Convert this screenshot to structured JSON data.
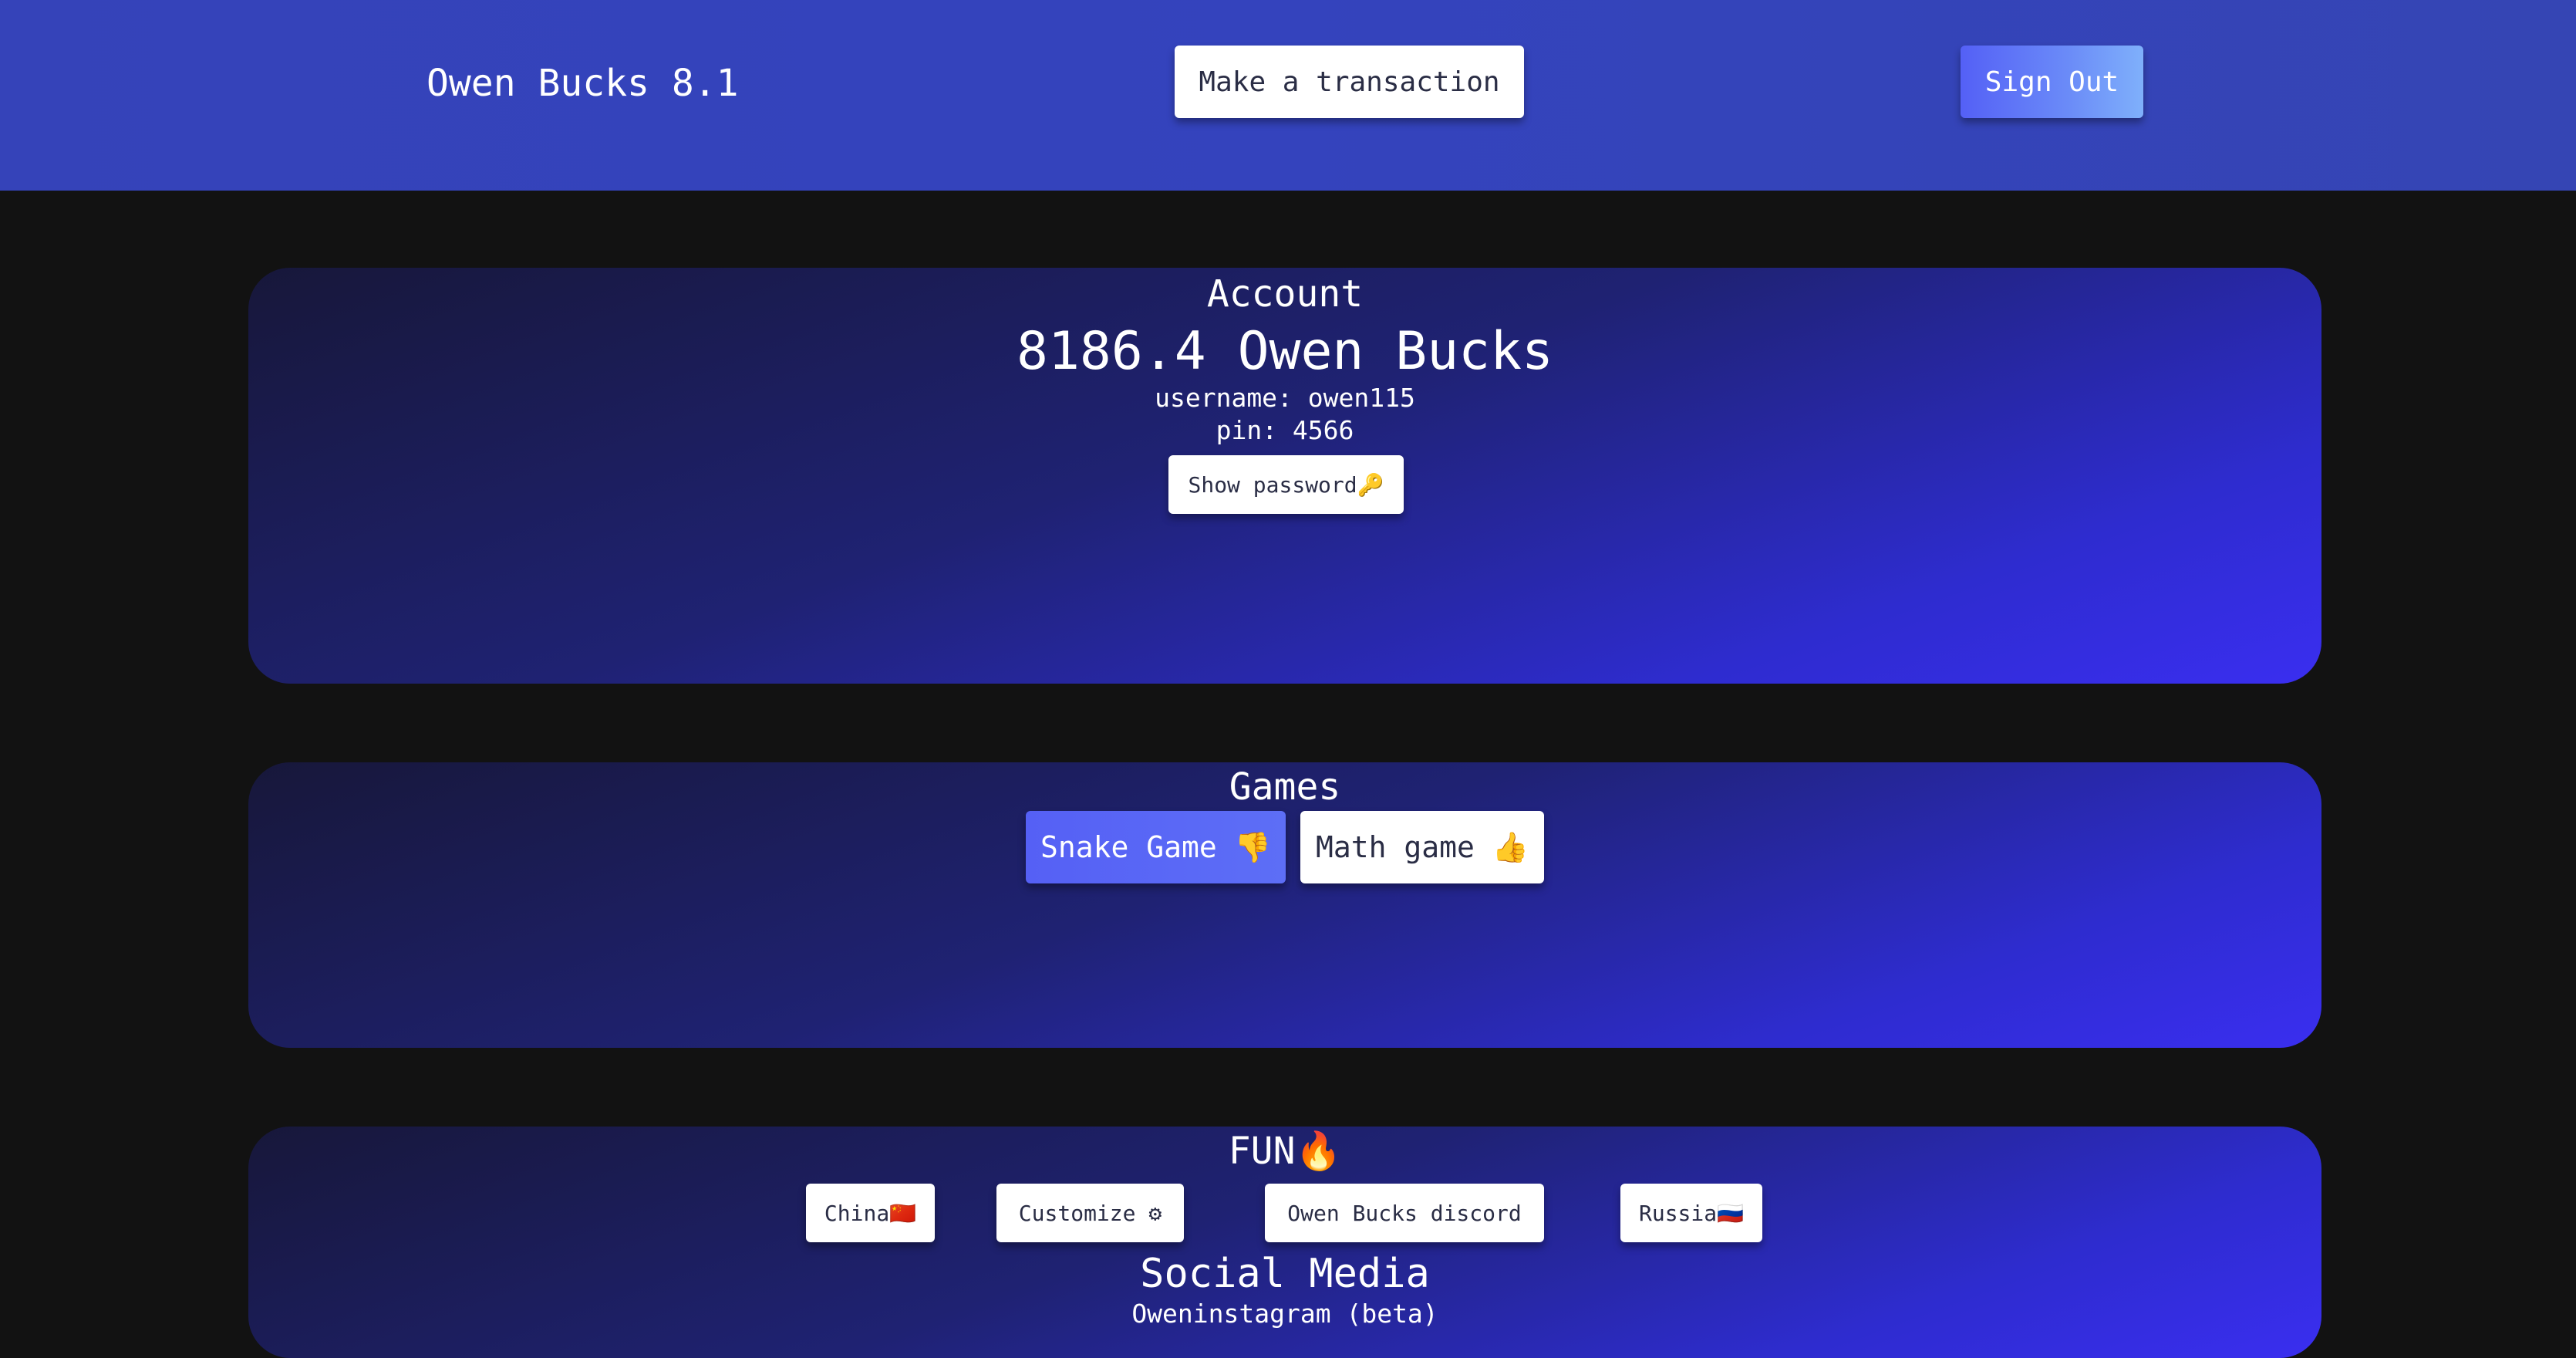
{
  "header": {
    "title": "Owen Bucks 8.1",
    "transaction_label": "Make a transaction",
    "signout_label": "Sign Out"
  },
  "account": {
    "heading": "Account",
    "balance": "8186.4 Owen Bucks",
    "username": "username: owen115",
    "pin": "pin: 4566",
    "show_password_label": "Show password🔑"
  },
  "games": {
    "heading": "Games",
    "snake_label": "Snake Game 👎",
    "math_label": "Math game 👍"
  },
  "fun": {
    "heading": "FUN🔥",
    "china_label": "China🇨🇳",
    "customize_label": "Customize ⚙",
    "discord_label": "Owen Bucks discord",
    "russia_label": "Russia🇷🇺"
  },
  "social": {
    "heading": "Social Media",
    "instagram_label": "Oweninstagram (beta)"
  }
}
